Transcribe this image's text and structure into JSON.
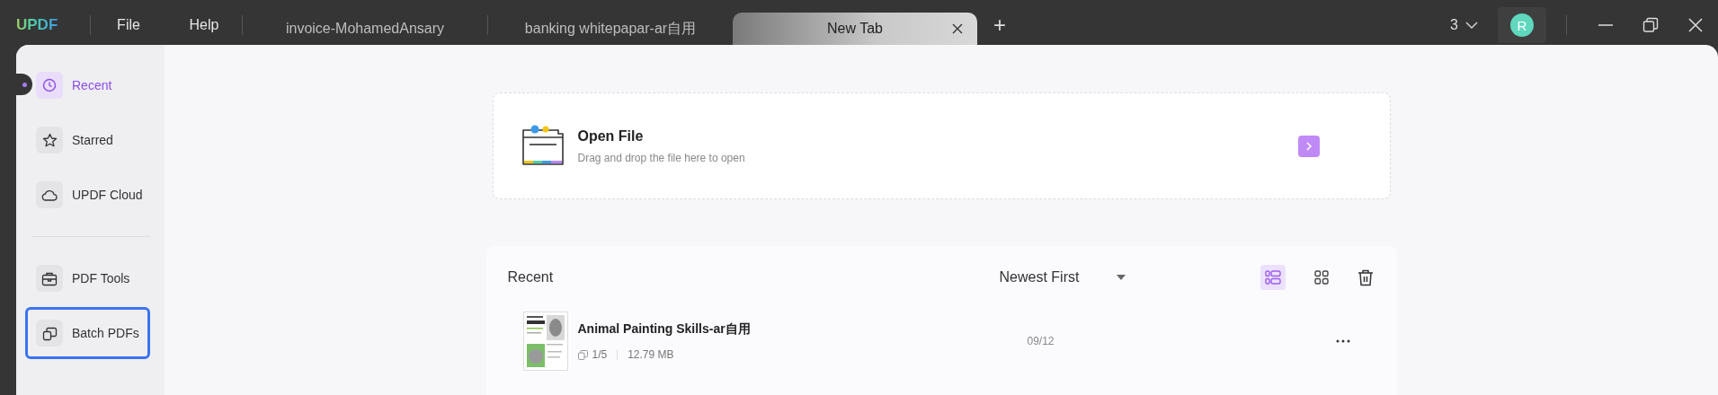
{
  "app": {
    "logo": "UPDF"
  },
  "menu": [
    "File",
    "Help"
  ],
  "tabs": [
    {
      "label": "invoice-MohamedAnsary",
      "selected": false
    },
    {
      "label": "banking whitepapar-ar自用",
      "selected": false
    },
    {
      "label": "New Tab",
      "selected": true
    }
  ],
  "add_tab": "+",
  "account": {
    "count": "3",
    "avatar": "R"
  },
  "sidebar": {
    "sections": [
      {
        "items": [
          {
            "kind": "recent",
            "label": "Recent",
            "selected": true,
            "focused": false
          },
          {
            "kind": "star",
            "label": "Starred",
            "selected": false,
            "focused": false
          },
          {
            "kind": "cloud",
            "label": "UPDF Cloud",
            "selected": false,
            "focused": false
          }
        ]
      },
      {
        "items": [
          {
            "kind": "tools",
            "label": "PDF Tools",
            "selected": false,
            "focused": false
          },
          {
            "kind": "batch",
            "label": "Batch PDFs",
            "selected": false,
            "focused": true
          }
        ]
      }
    ]
  },
  "open_file": {
    "title": "Open File",
    "subtitle": "Drag and drop the file here to open"
  },
  "recent": {
    "title": "Recent",
    "sort": "Newest First",
    "views": [
      {
        "kind": "list",
        "selected": true
      },
      {
        "kind": "grid",
        "selected": false
      }
    ],
    "files": [
      {
        "name": "Animal Painting Skills-ar自用",
        "pages": "1/5",
        "size": "12.79 MB",
        "date": "09/12"
      }
    ]
  }
}
